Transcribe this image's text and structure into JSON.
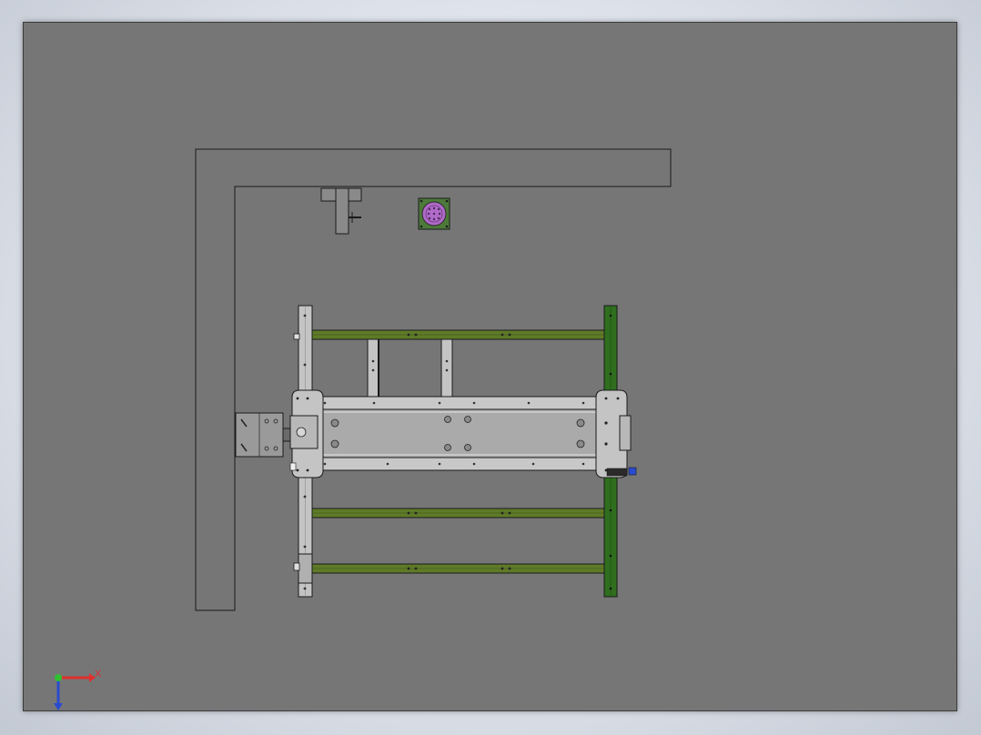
{
  "viewport": {
    "background": "#767676",
    "border": "#3a3a3a"
  },
  "colors": {
    "frame_outline": "#1a1a1a",
    "rail_green": "#2f6e1e",
    "bar_olive": "#5f7a28",
    "metal_light": "#c4c4c4",
    "metal_mid": "#a9a9a9",
    "connector_purple": "#b06ac8",
    "axis_x": "#e03030",
    "axis_y": "#30c030",
    "axis_z": "#2a4bd0"
  },
  "triad": {
    "x_label": "X",
    "z_label": "Z"
  }
}
